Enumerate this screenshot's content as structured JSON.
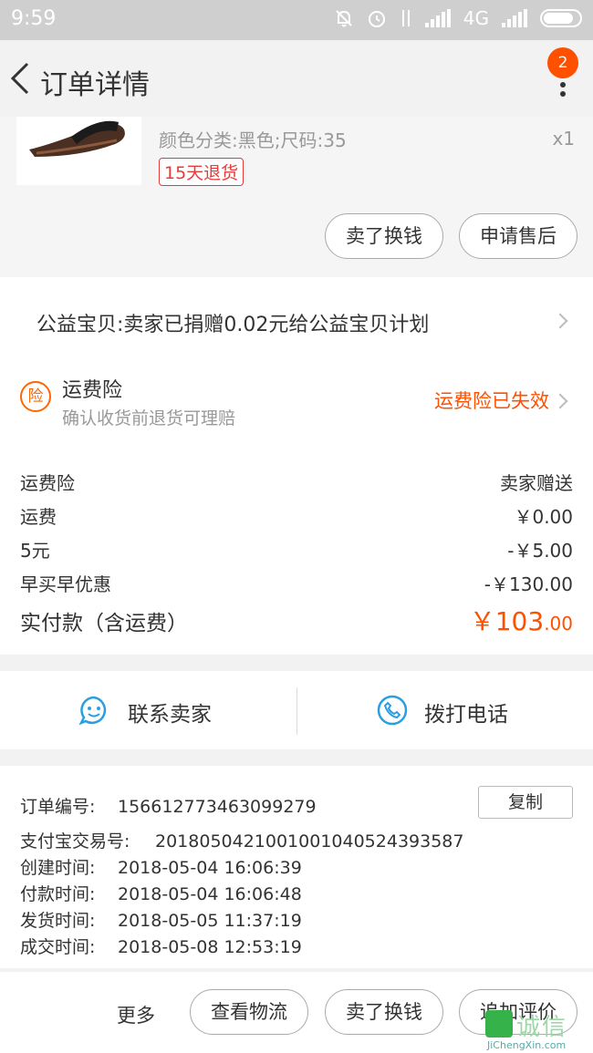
{
  "status_bar": {
    "time": "9:59",
    "network": "4G"
  },
  "header": {
    "title": "订单详情",
    "more_badge": "2"
  },
  "item": {
    "sku": "颜色分类:黑色;尺码:35",
    "quantity": "x1",
    "return_tag": "15天退货",
    "buttons": [
      "卖了换钱",
      "申请售后"
    ]
  },
  "charity": {
    "text": "公益宝贝:卖家已捐赠0.02元给公益宝贝计划"
  },
  "insurance": {
    "icon_char": "险",
    "title": "运费险",
    "subtitle": "确认收货前退货可理赔",
    "status": "运费险已失效"
  },
  "price_rows": [
    {
      "label": "运费险",
      "value": "卖家赠送"
    },
    {
      "label": "运费",
      "value": "￥0.00"
    },
    {
      "label": "5元",
      "value": "-￥5.00"
    },
    {
      "label": "早买早优惠",
      "value": "-￥130.00"
    }
  ],
  "total": {
    "label": "实付款（含运费）",
    "currency": "￥",
    "integer": "103",
    "decimal": ".00"
  },
  "contact": {
    "seller": "联系卖家",
    "phone": "拨打电话"
  },
  "order_info": {
    "order_no_label": "订单编号:",
    "order_no": "156612773463099279",
    "copy": "复制",
    "alipay_label": "支付宝交易号:",
    "alipay_no": "2018050421001001040524393587",
    "rows": [
      {
        "label": "创建时间:",
        "value": "2018-05-04 16:06:39"
      },
      {
        "label": "付款时间:",
        "value": "2018-05-04 16:06:48"
      },
      {
        "label": "发货时间:",
        "value": "2018-05-05 11:37:19"
      },
      {
        "label": "成交时间:",
        "value": "2018-05-08 12:53:19"
      }
    ]
  },
  "bottom_bar": {
    "more": "更多",
    "buttons": [
      "查看物流",
      "卖了换钱",
      "追加评价"
    ]
  },
  "watermark": {
    "cn": "诚信",
    "en": "JiChengXin.com"
  },
  "colors": {
    "accent": "#ff5000",
    "tag_red": "#e93a3a",
    "icon_blue": "#2a9fe0"
  }
}
